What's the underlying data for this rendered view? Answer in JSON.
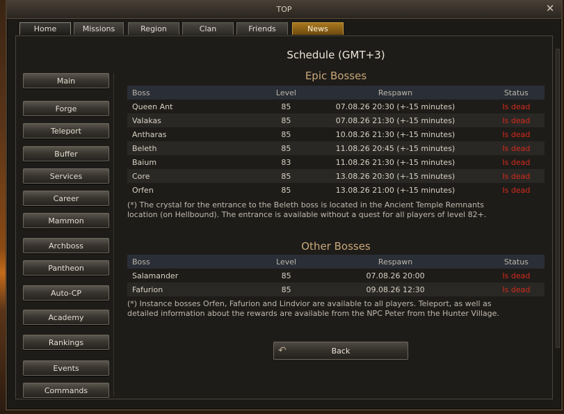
{
  "window": {
    "title": "TOP",
    "close_glyph": "✕"
  },
  "tabs": [
    {
      "label": "Home",
      "active": true
    },
    {
      "label": "Missions"
    },
    {
      "label": "Region"
    },
    {
      "label": "Clan"
    },
    {
      "label": "Friends"
    },
    {
      "label": "News",
      "highlight": true
    }
  ],
  "sidebar": {
    "items": [
      {
        "label": "Main"
      },
      {
        "label": "Forge"
      },
      {
        "label": "Teleport"
      },
      {
        "label": "Buffer"
      },
      {
        "label": "Services"
      },
      {
        "label": "Career"
      },
      {
        "label": "Mammon"
      },
      {
        "label": "Archboss"
      },
      {
        "label": "Pantheon"
      },
      {
        "label": "Auto-CP"
      },
      {
        "label": "Academy"
      },
      {
        "label": "Rankings"
      },
      {
        "label": "Events"
      },
      {
        "label": "Commands"
      }
    ]
  },
  "schedule": {
    "title": "Schedule (GMT+3)"
  },
  "columns": {
    "boss": "Boss",
    "level": "Level",
    "respawn": "Respawn",
    "status": "Status"
  },
  "epic": {
    "title": "Epic Bosses",
    "rows": [
      {
        "boss": "Queen Ant",
        "level": "85",
        "respawn": "07.08.26 20:30 (+-15 minutes)",
        "status": "Is dead"
      },
      {
        "boss": "Valakas",
        "level": "85",
        "respawn": "07.08.26 21:30 (+-15 minutes)",
        "status": "Is dead"
      },
      {
        "boss": "Antharas",
        "level": "85",
        "respawn": "10.08.26 21:30 (+-15 minutes)",
        "status": "Is dead"
      },
      {
        "boss": "Beleth",
        "level": "85",
        "respawn": "11.08.26 20:45 (+-15 minutes)",
        "status": "Is dead"
      },
      {
        "boss": "Baium",
        "level": "83",
        "respawn": "11.08.26 21:30 (+-15 minutes)",
        "status": "Is dead"
      },
      {
        "boss": "Core",
        "level": "85",
        "respawn": "13.08.26 20:30 (+-15 minutes)",
        "status": "Is dead"
      },
      {
        "boss": "Orfen",
        "level": "85",
        "respawn": "13.08.26 21:00 (+-15 minutes)",
        "status": "Is dead"
      }
    ],
    "note": "(*) The crystal for the entrance to the Beleth boss is located in the Ancient Temple Remnants location (on Hellbound). The entrance is available without a quest for all players of level 82+."
  },
  "other": {
    "title": "Other Bosses",
    "rows": [
      {
        "boss": "Salamander",
        "level": "85",
        "respawn": "07.08.26 20:00",
        "status": "Is dead"
      },
      {
        "boss": "Fafurion",
        "level": "85",
        "respawn": "09.08.26 12:30",
        "status": "Is dead"
      }
    ],
    "note": "(*) Instance bosses Orfen, Fafurion and Lindvior are available to all players. Teleport, as well as detailed information about the rewards are available from the NPC Peter from the Hunter Village."
  },
  "back_button": {
    "label": "Back",
    "icon": "back-arrow-icon"
  },
  "colors": {
    "dead": "#d42a1c",
    "section_title": "#c8a878",
    "news_tab": "#a8781e"
  }
}
